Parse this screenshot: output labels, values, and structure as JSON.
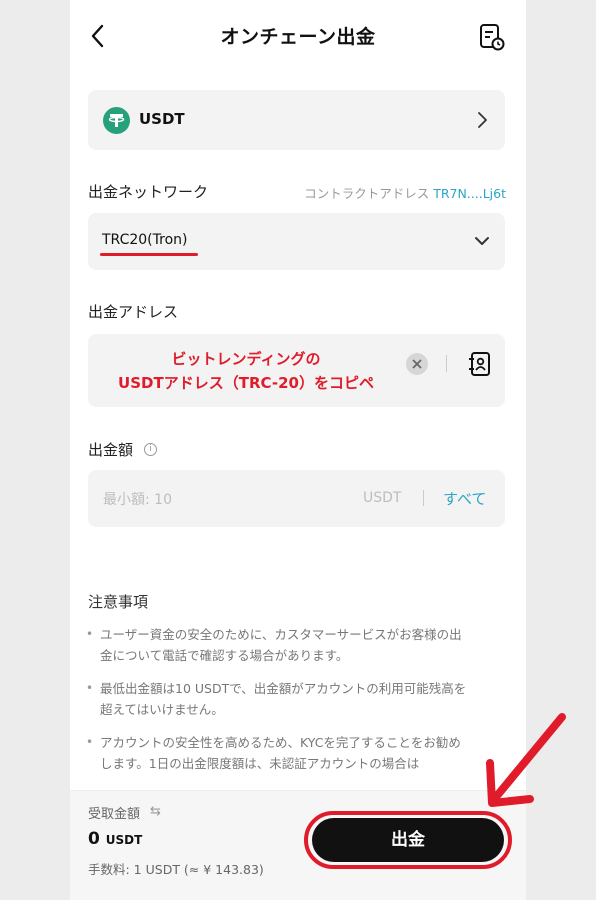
{
  "header": {
    "title": "オンチェーン出金",
    "back_icon": "chevron-left-icon",
    "history_icon": "history-document-icon"
  },
  "coin": {
    "name": "USDT",
    "logo_color": "#26a17b",
    "logo_letter": "T"
  },
  "network": {
    "label": "出金ネットワーク",
    "contract_label": "コントラクトアドレス",
    "contract_address": "TR7N....Lj6t",
    "value": "TRC20(Tron)"
  },
  "address": {
    "label": "出金アドレス",
    "annotation_line1": "ビットレンディングの",
    "annotation_line2": "USDTアドレス（TRC-20）をコピペ"
  },
  "amount": {
    "label": "出金額",
    "info_glyph": "i",
    "placeholder": "最小額:  10",
    "unit": "USDT",
    "all_label": "すべて"
  },
  "notes": {
    "title": "注意事項",
    "items": [
      {
        "line1": "ユーザー資金の安全のために、カスタマーサービスがお客様の出",
        "line2": "金について電話で確認する場合があります。"
      },
      {
        "line1": "最低出金額は10 USDTで、出金額がアカウントの利用可能残高を",
        "line2": "超えてはいけません。"
      },
      {
        "line1": "アカウントの安全性を高めるため、KYCを完了することをお勧め",
        "line2": "します。1日の出金限度額は、未認証アカウントの場合は"
      }
    ]
  },
  "bottom": {
    "receive_label": "受取金額",
    "receive_amount": "0",
    "receive_unit": "USDT",
    "fee": "手数料: 1 USDT (≈ ¥ 143.83)",
    "submit_label": "出金"
  },
  "colors": {
    "accent": "#2aa6c4",
    "annotation_red": "#e01c2a",
    "button": "#111111"
  }
}
